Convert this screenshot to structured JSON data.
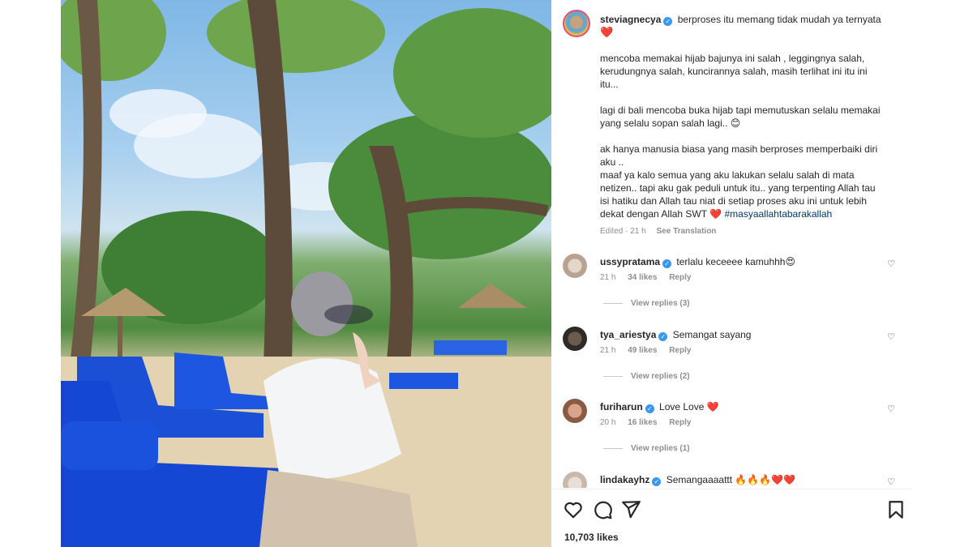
{
  "post": {
    "username": "steviagnecya",
    "caption_first": "berproses itu memang tidak mudah ya ternyata",
    "caption_paragraphs": [
      "mencoba memakai hijab bajunya ini salah , leggingnya salah,\nkerudungnya salah, kuncirannya salah, masih terlihat ini itu ini\nitu...",
      "lagi di bali mencoba buka hijab tapi memutuskan selalu memakai\nyang selalu sopan salah lagi.. 😊",
      "ak hanya manusia biasa yang masih berproses memperbaiki diri\naku ..\nmaaf ya kalo semua yang aku lakukan selalu salah di mata\nnetizen.. tapi aku gak peduli untuk itu.. yang terpenting Allah tau\nisi hatiku dan Allah tau niat di setiap proses aku ini untuk lebih\ndekat dengan Allah SWT ❤️"
    ],
    "hashtag": "#masyaallahtabarakallah",
    "edited": "Edited · 21 h",
    "see_translation": "See Translation",
    "likes": "10,703 likes"
  },
  "comments": [
    {
      "username": "ussypratama",
      "text": "terlalu keceeee kamuhhh😍",
      "time": "21 h",
      "likes": "34 likes",
      "reply": "Reply",
      "view_replies": "View replies (3)"
    },
    {
      "username": "tya_ariestya",
      "text": "Semangat sayang",
      "time": "21 h",
      "likes": "49 likes",
      "reply": "Reply",
      "view_replies": "View replies (2)"
    },
    {
      "username": "furiharun",
      "text": "Love Love ❤️",
      "time": "20 h",
      "likes": "16 likes",
      "reply": "Reply",
      "view_replies": "View replies (1)"
    },
    {
      "username": "lindakayhz",
      "text": "Semangaaaattt 🔥🔥🔥❤️❤️"
    }
  ],
  "icons": {
    "like": "heart-icon",
    "comment": "comment-icon",
    "share": "share-icon",
    "save": "bookmark-icon",
    "verified": "verified-badge-icon"
  },
  "colors": {
    "verified": "#3897f0",
    "heart": "#e3143a",
    "hashtag": "#00376b"
  }
}
